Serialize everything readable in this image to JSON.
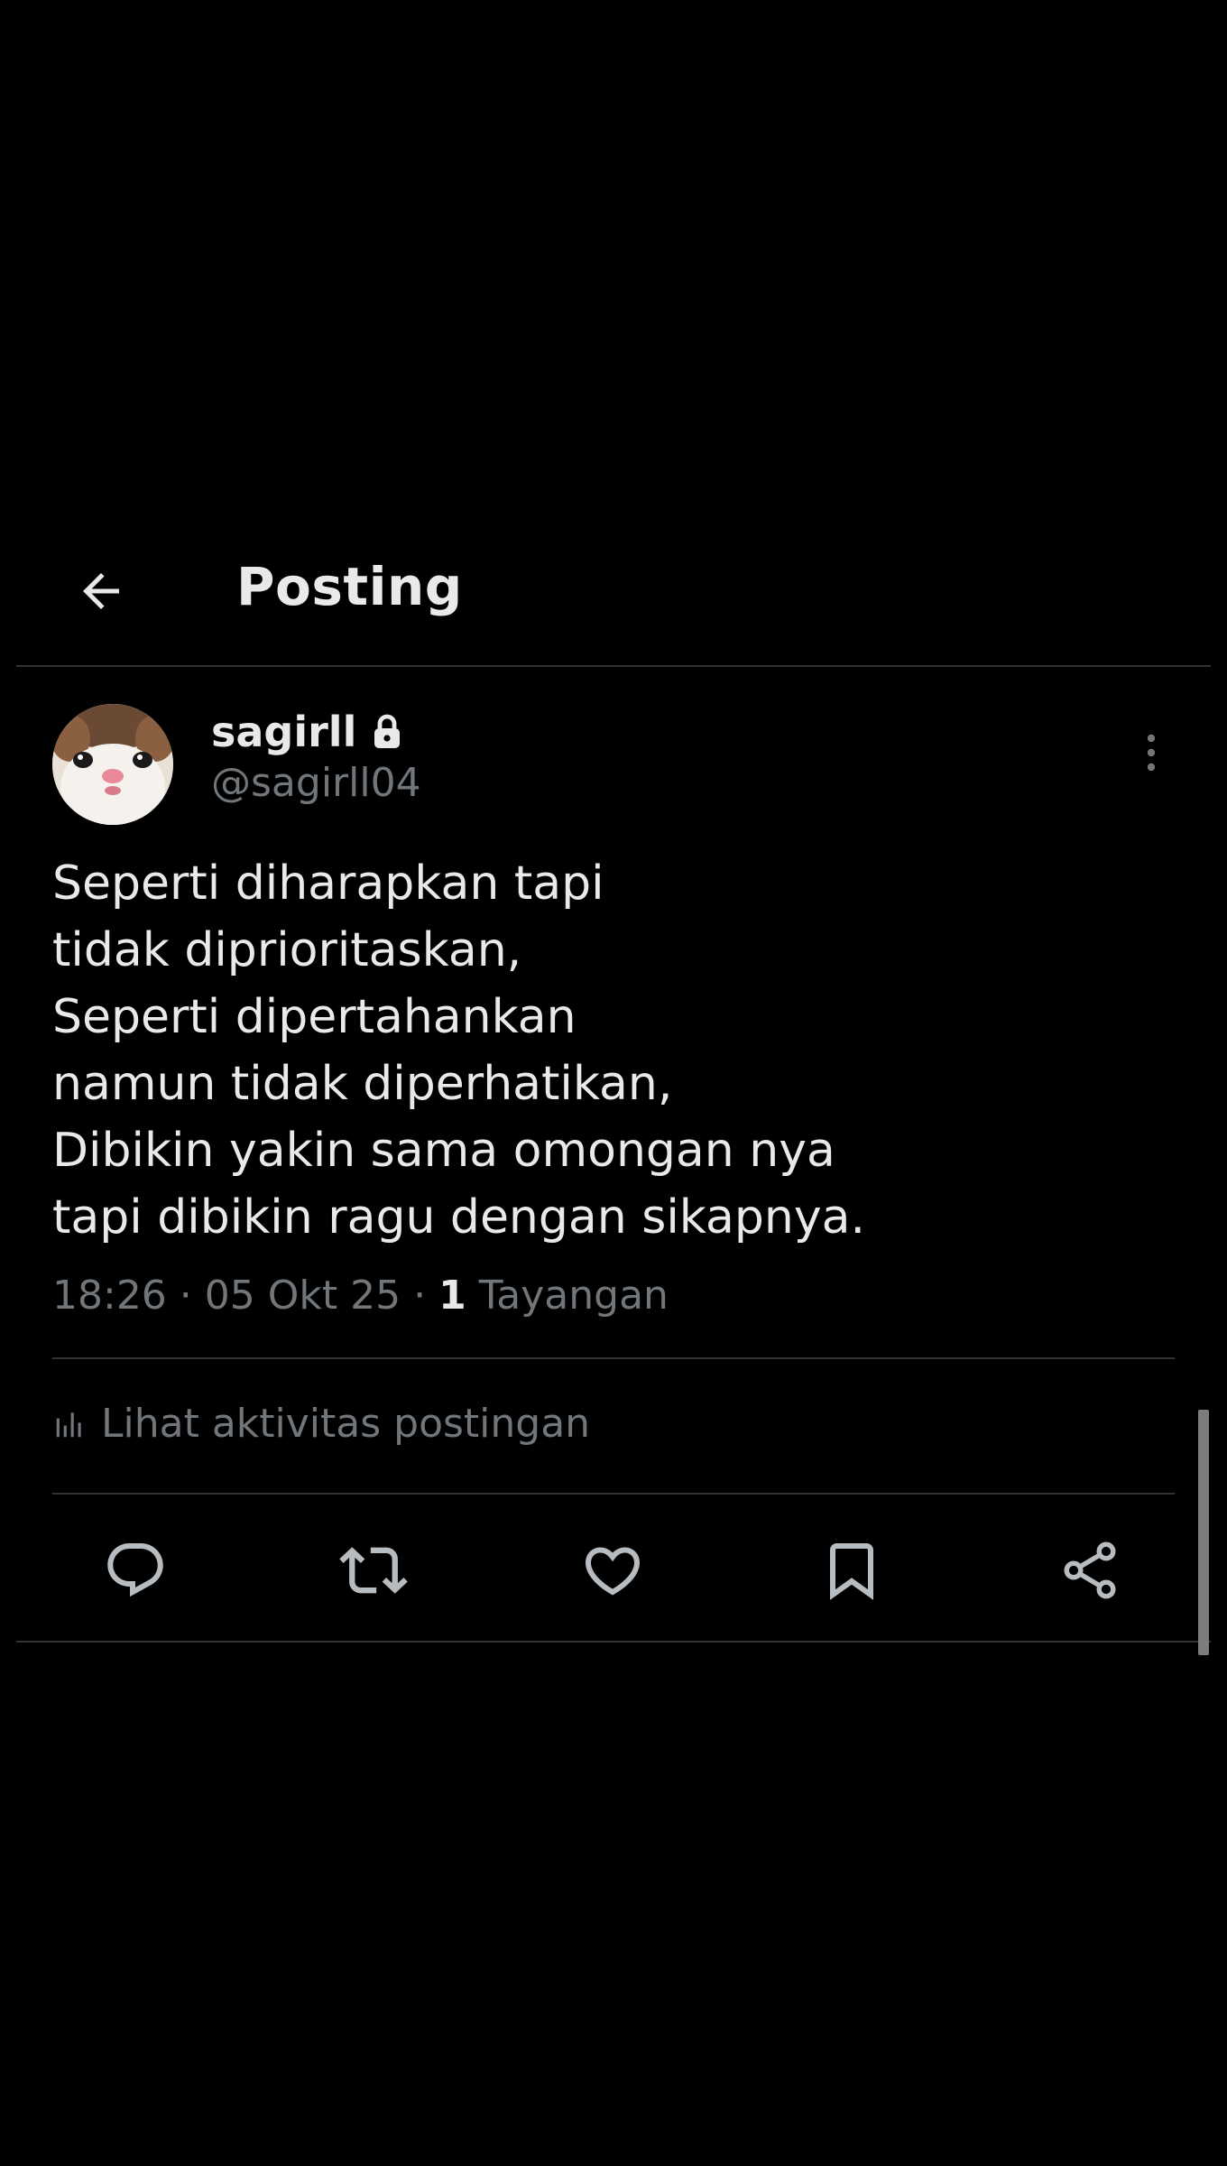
{
  "header": {
    "title": "Posting",
    "back_icon": "arrow-left-icon"
  },
  "post": {
    "author": {
      "display_name": "sagirll",
      "handle": "@sagirll04",
      "protected_icon": "lock-icon"
    },
    "text_lines": [
      "Seperti diharapkan tapi",
      "tidak diprioritaskan,",
      "Seperti dipertahankan",
      "namun tidak diperhatikan,",
      "Dibikin yakin sama omongan nya",
      "tapi dibikin ragu dengan sikapnya."
    ],
    "meta": {
      "time": "18:26",
      "separator": " · ",
      "date": "05 Okt 25",
      "views_count": "1",
      "views_label": " Tayangan"
    },
    "activity_label": "Lihat aktivitas postingan"
  },
  "actions": [
    {
      "name": "reply-icon"
    },
    {
      "name": "repost-icon"
    },
    {
      "name": "like-icon"
    },
    {
      "name": "bookmark-icon"
    },
    {
      "name": "share-icon"
    }
  ],
  "colors": {
    "background": "#000000",
    "text_primary": "#e7e9ea",
    "text_secondary": "#71767b",
    "divider": "#2f3336"
  }
}
